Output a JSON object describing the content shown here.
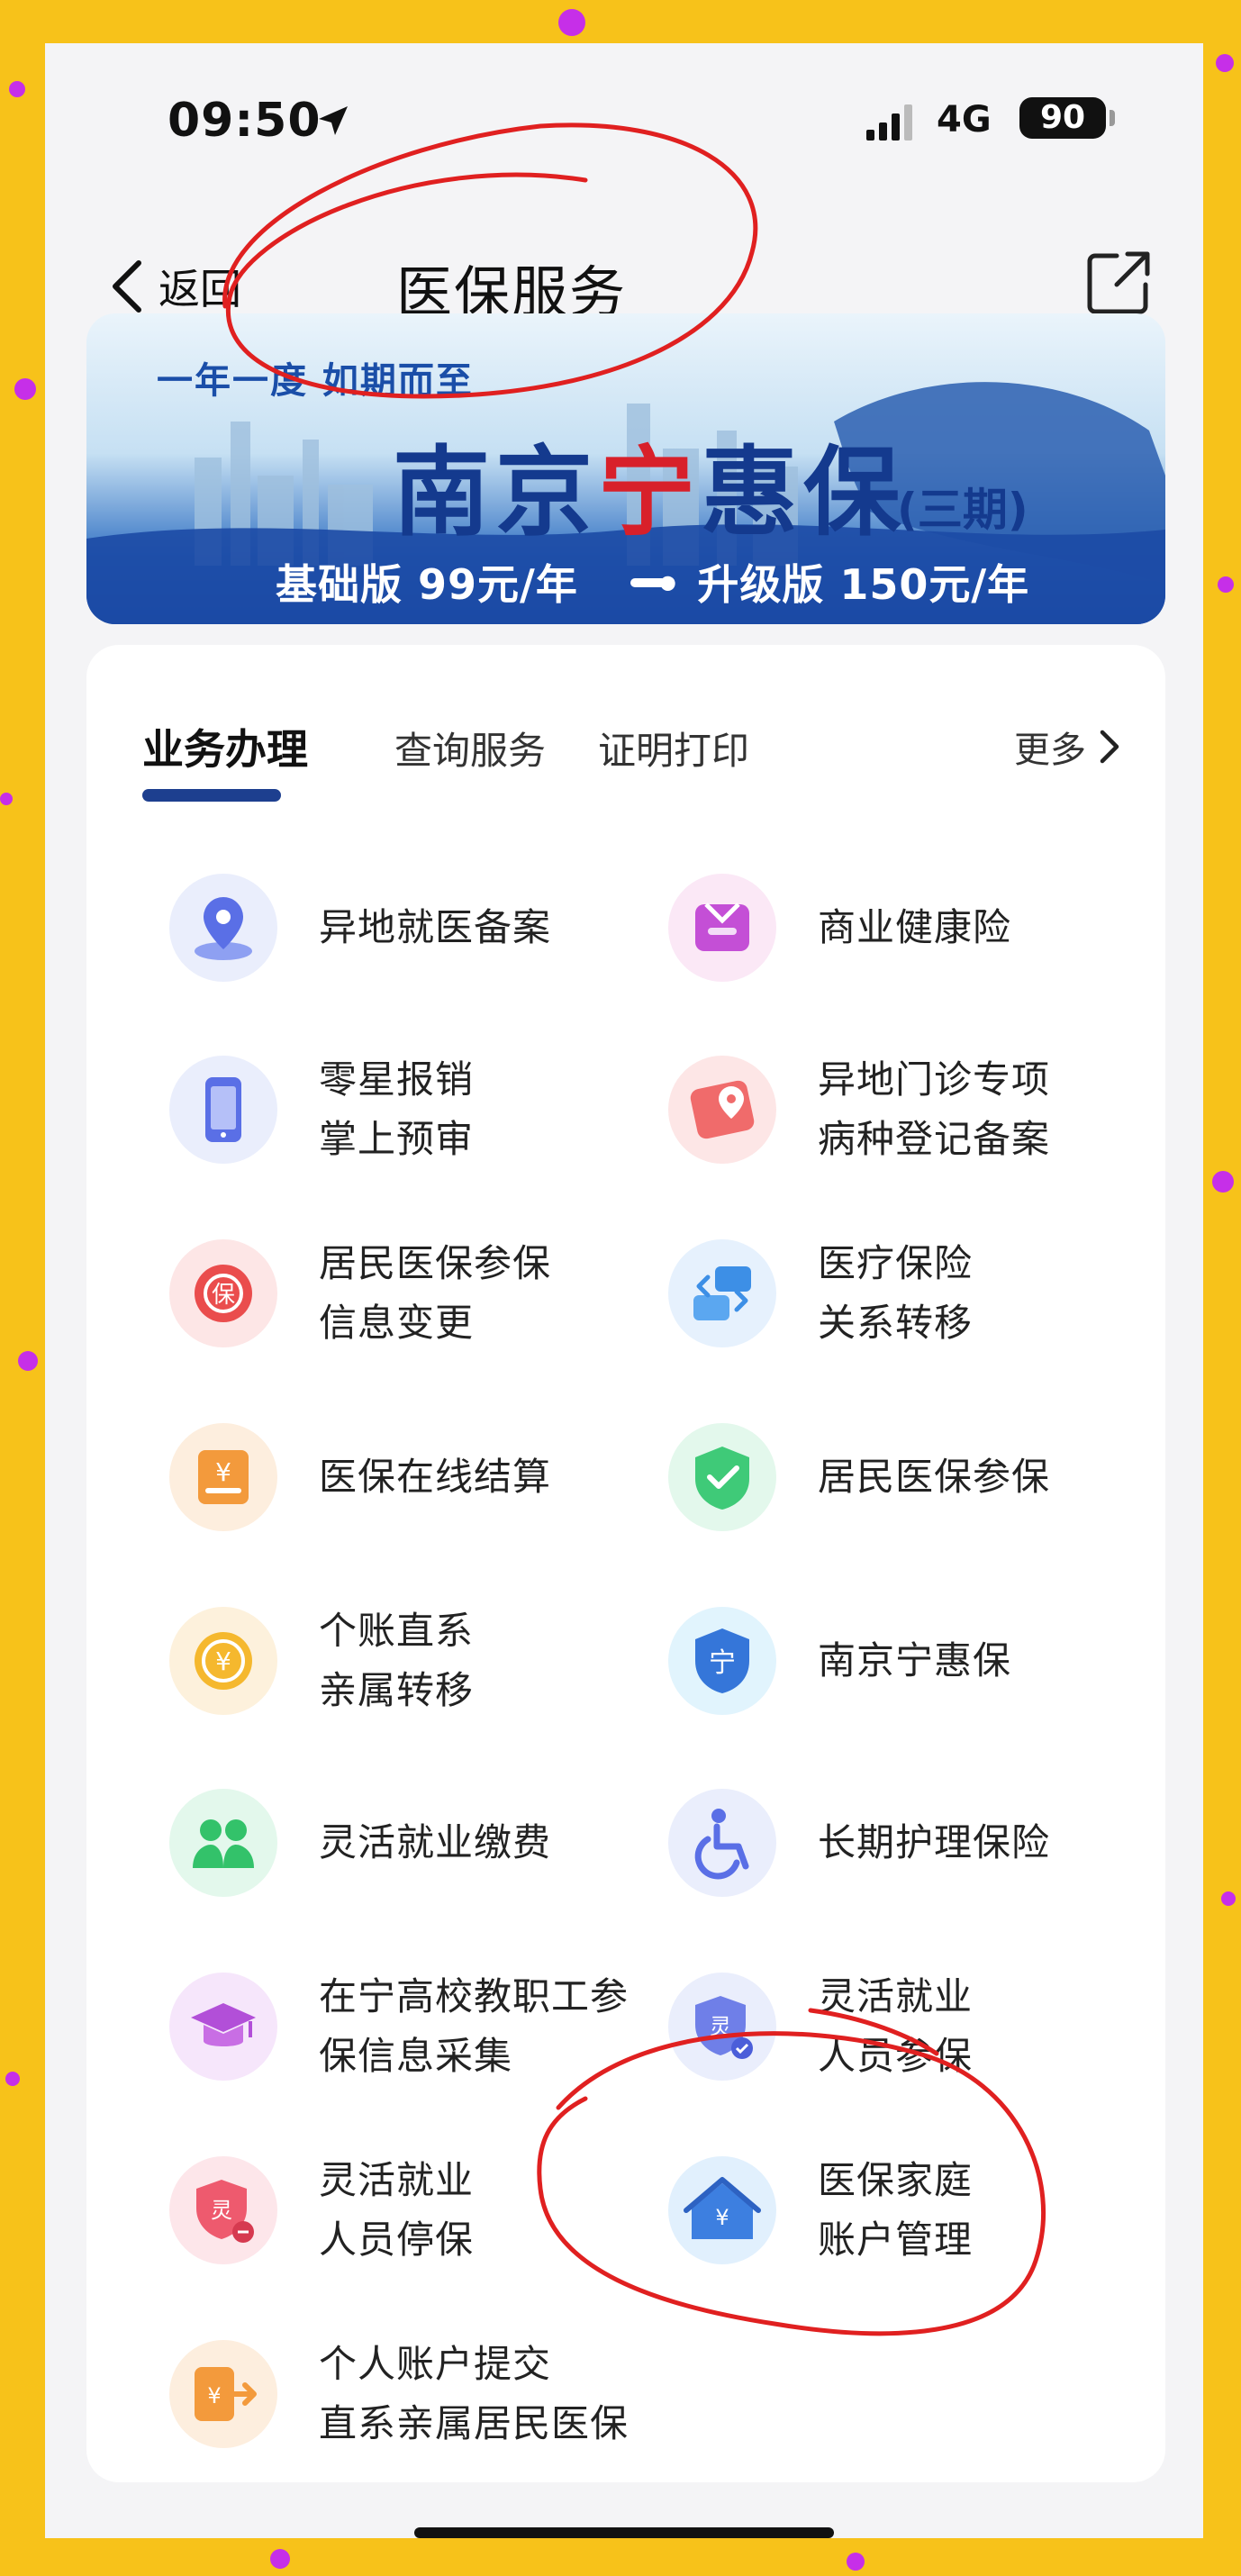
{
  "status_bar": {
    "time": "09:50",
    "network": "4G",
    "battery": "90"
  },
  "nav": {
    "back_label": "返回",
    "title": "医保服务"
  },
  "banner": {
    "slogan": "一年一度 如期而至",
    "title_pre": "南京",
    "title_red": "宁",
    "title_post": "惠保",
    "subtitle": "(三期)",
    "price_basic": "基础版 99元/年",
    "price_upgrade": "• 升级版 150元/年"
  },
  "tabs": [
    {
      "label": "业务办理",
      "active": true
    },
    {
      "label": "查询服务",
      "active": false
    },
    {
      "label": "证明打印",
      "active": false
    }
  ],
  "more_label": "更多",
  "services": [
    {
      "label": "异地就医备案",
      "icon": "location-pin-icon"
    },
    {
      "label": "商业健康险",
      "icon": "shield-box-icon"
    },
    {
      "label": "零星报销\n掌上预审",
      "icon": "mobile-phone-icon"
    },
    {
      "label": "异地门诊专项\n病种登记备案",
      "icon": "map-pin-icon"
    },
    {
      "label": "居民医保参保\n信息变更",
      "icon": "bao-refresh-icon"
    },
    {
      "label": "医疗保险\n关系转移",
      "icon": "transfer-icon"
    },
    {
      "label": "医保在线结算",
      "icon": "yen-receipt-icon"
    },
    {
      "label": "居民医保参保",
      "icon": "check-shield-icon"
    },
    {
      "label": "个账直系\n亲属转移",
      "icon": "yen-coin-icon"
    },
    {
      "label": "南京宁惠保",
      "icon": "ning-shield-icon"
    },
    {
      "label": "灵活就业缴费",
      "icon": "people-icon"
    },
    {
      "label": "长期护理保险",
      "icon": "wheelchair-icon"
    },
    {
      "label": "在宁高校教职工参\n保信息采集",
      "icon": "graduation-cap-icon"
    },
    {
      "label": "灵活就业\n人员参保",
      "icon": "ling-check-icon"
    },
    {
      "label": "灵活就业\n人员停保",
      "icon": "ling-minus-icon"
    },
    {
      "label": "医保家庭\n账户管理",
      "icon": "family-house-icon"
    },
    {
      "label": "个人账户提交\n直系亲属居民医保",
      "icon": "account-export-icon"
    }
  ],
  "colors": {
    "background": "#f7c21a",
    "accent": "#1d3f8f",
    "annotation": "#e02020"
  }
}
